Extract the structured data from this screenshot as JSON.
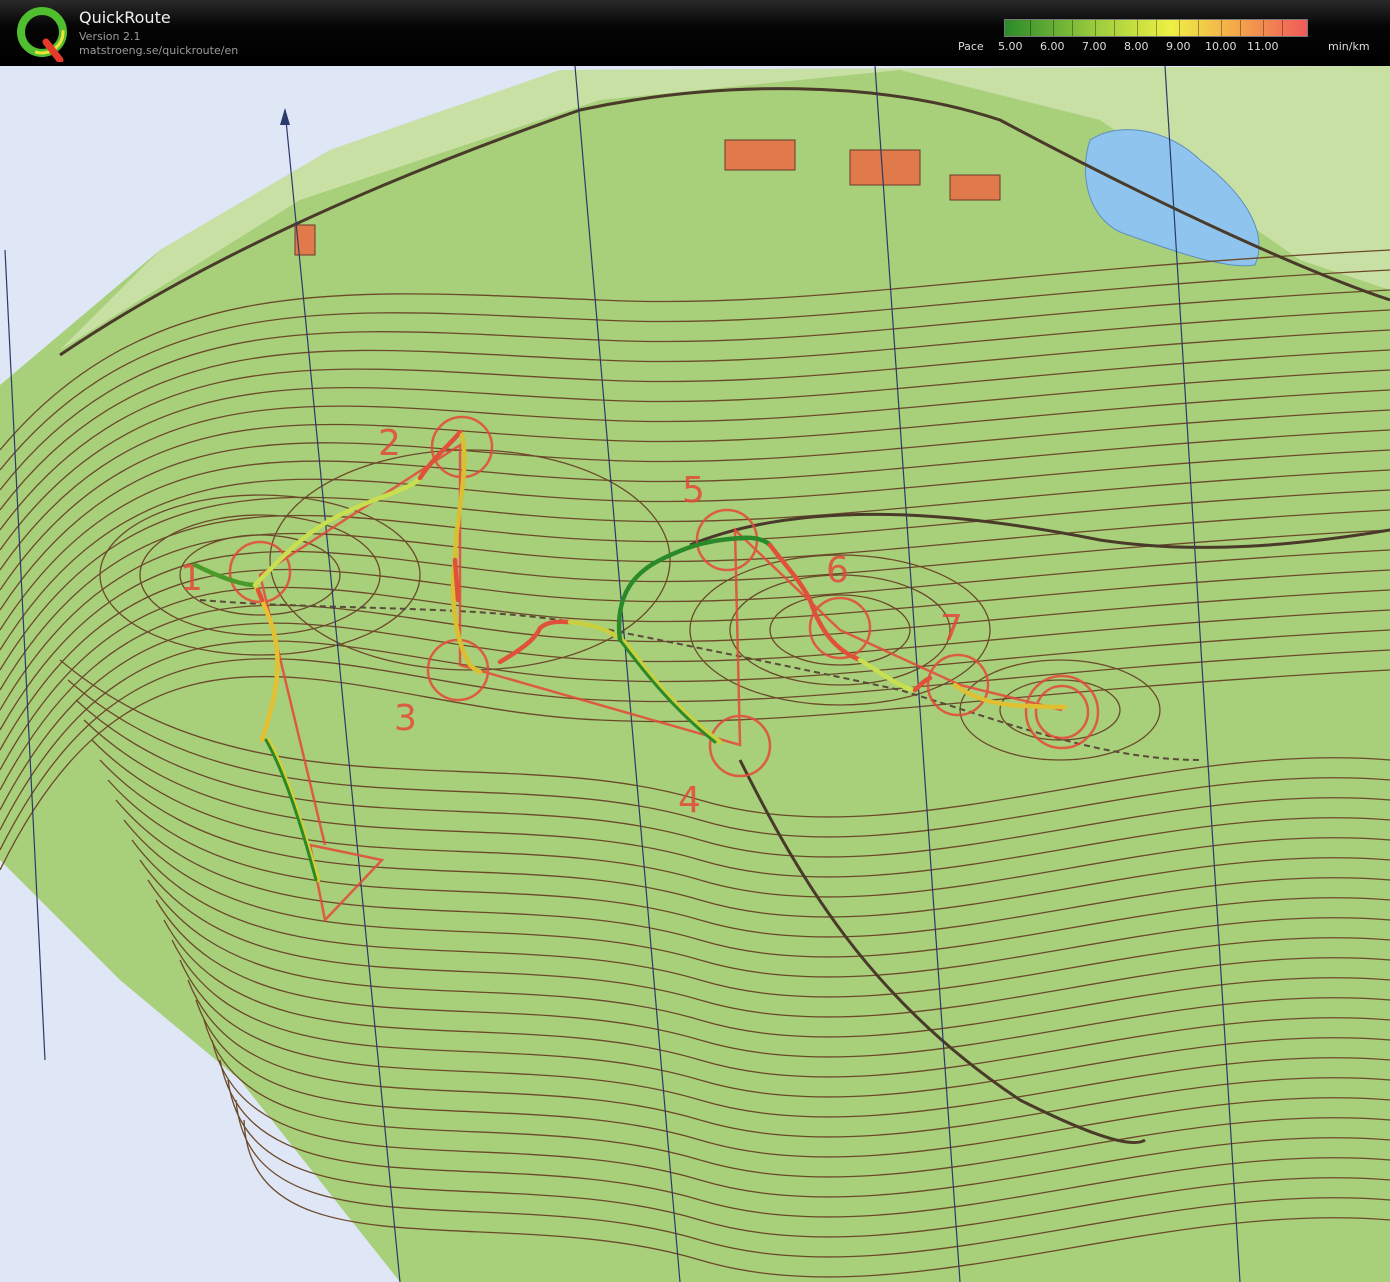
{
  "app": {
    "title": "QuickRoute",
    "version": "Version 2.1",
    "url": "matstroeng.se/quickroute/en"
  },
  "pace_legend": {
    "label": "Pace",
    "ticks": [
      "5.00",
      "6.00",
      "7.00",
      "8.00",
      "9.00",
      "10.00",
      "11.00"
    ],
    "unit": "min/km",
    "colors": [
      "#2a8a2a",
      "#9bcc3d",
      "#eef044",
      "#f4a34a",
      "#f05a5a"
    ]
  },
  "map": {
    "controls": [
      "1",
      "2",
      "3",
      "4",
      "5",
      "6",
      "7"
    ],
    "colors": {
      "terrain": "#a8cf7a",
      "contour": "#6b4a2a",
      "course": "#e5483a",
      "water": "#8fc4ee",
      "paper": "#dfe6f5"
    }
  }
}
